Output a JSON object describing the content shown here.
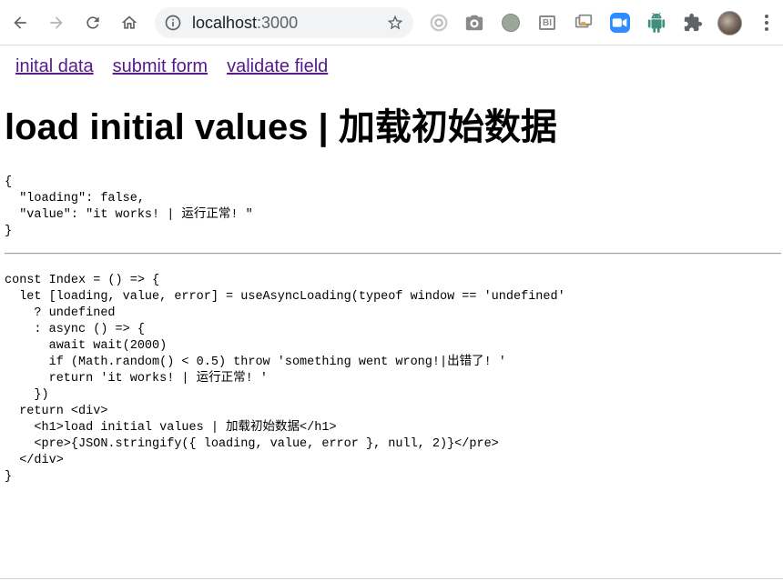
{
  "browser": {
    "url_host": "localhost",
    "url_port": ":3000"
  },
  "nav": {
    "links": [
      "inital data",
      "submit form",
      "validate field"
    ]
  },
  "page": {
    "title": "load initial values | 加载初始数据",
    "json_output": "{\n  \"loading\": false,\n  \"value\": \"it works! | 运行正常! \"\n}",
    "code_sample": "const Index = () => {\n  let [loading, value, error] = useAsyncLoading(typeof window == 'undefined'\n    ? undefined\n    : async () => {\n      await wait(2000)\n      if (Math.random() < 0.5) throw 'something went wrong!|出错了! '\n      return 'it works! | 运行正常! '\n    })\n  return <div>\n    <h1>load initial values | 加载初始数据</h1>\n    <pre>{JSON.stringify({ loading, value, error }, null, 2)}</pre>\n  </div>\n}"
  },
  "colors": {
    "link_visited": "#551a8b",
    "toolbar_icon": "#5f6368",
    "omnibox_bg": "#f1f3f4"
  },
  "icons": [
    "back-arrow-icon",
    "forward-arrow-icon",
    "reload-icon",
    "home-icon",
    "info-icon",
    "star-icon",
    "extension-icons",
    "puzzle-icon",
    "kebab-menu-icon"
  ]
}
